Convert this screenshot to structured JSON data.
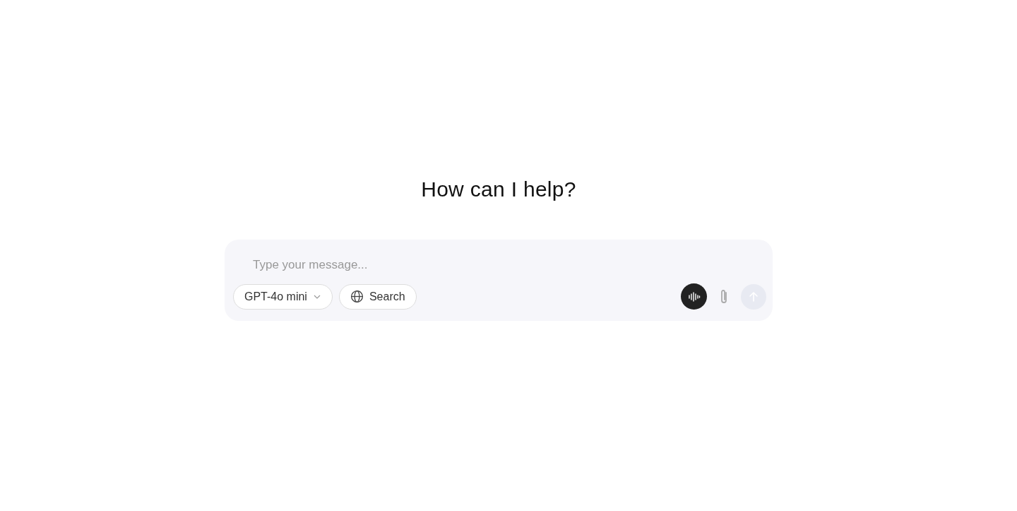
{
  "heading": "How can I help?",
  "composer": {
    "placeholder": "Type your message...",
    "model_picker": {
      "label": "GPT-4o mini"
    },
    "search_button": {
      "label": "Search"
    },
    "send_button": {
      "disabled": true
    }
  }
}
